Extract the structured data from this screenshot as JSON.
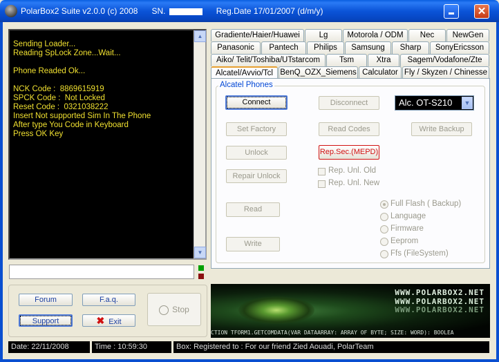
{
  "window": {
    "title": "PolarBox2 Suite  v2.0.0 (c) 2008",
    "sn_label": "SN.",
    "reg_date": "Reg.Date 17/01/2007 (d/m/y)",
    "close_glyph": "✕"
  },
  "console": {
    "text": "Sending Loader...\nReading SpLock Zone...Wait...\n\nPhone Readed Ok...\n\nNCK Code :  8869615919\nSPCK Code :  Not Locked\nReset Code :  0321038222\nInsert Not supported Sim In The Phone\nAfter type You Code in Keyboard\nPress OK Key"
  },
  "buttons_left": {
    "forum": "Forum",
    "faq": "F.a.q.",
    "support": "Support",
    "exit": "Exit",
    "stop": "Stop"
  },
  "tabs": {
    "row1": [
      "Gradiente/Haier/Huawei",
      "Lg",
      "Motorola / ODM",
      "Nec",
      "NewGen"
    ],
    "row2": [
      "Panasonic",
      "Pantech",
      "Philips",
      "Samsung",
      "Sharp",
      "SonyEricsson"
    ],
    "row3": [
      "Aiko/ Telit/Toshiba/UTstarcom",
      "Tsm",
      "Xtra",
      "Sagem/Vodafone/Zte"
    ],
    "row4": [
      "Alcatel/Avvio/Tcl",
      "BenQ_OZX_Siemens",
      "Calculator",
      "Fly / Skyzen / Chinesse"
    ],
    "active": "Alcatel/Avvio/Tcl"
  },
  "panel": {
    "group_title": "Alcatel Phones",
    "connect": "Connect",
    "disconnect": "Disconnect",
    "set_factory": "Set Factory",
    "read_codes": "Read Codes",
    "write_backup": "Write Backup",
    "unlock": "Unlock",
    "rep_sec": "Rep.Sec.(MEPD)",
    "repair_unlock": "Repair Unlock",
    "rep_unl_old": "Rep. Unl. Old",
    "rep_unl_new": "Rep. Unl. New",
    "read": "Read",
    "write": "Write",
    "model_select": "Alc. OT-S210",
    "radio_options": [
      "Full Flash ( Backup)",
      "Language",
      "Firmware",
      "Eeprom",
      "Ffs (FileSystem)"
    ],
    "radio_selected": "Full Flash ( Backup)"
  },
  "banner": {
    "brand": "WWW.POLARBOX2.NET",
    "marquee": "CTION TFORM1.GETCOMDATA(VAR DATAARRAY: ARRAY OF BYTE; SIZE: WORD): BOOLEA"
  },
  "statusbar": {
    "date": "Date: 22/11/2008",
    "time": "Time :  10:59:30",
    "box": "Box: Registered to : For our friend Zied Aouadi, PolarTeam"
  }
}
